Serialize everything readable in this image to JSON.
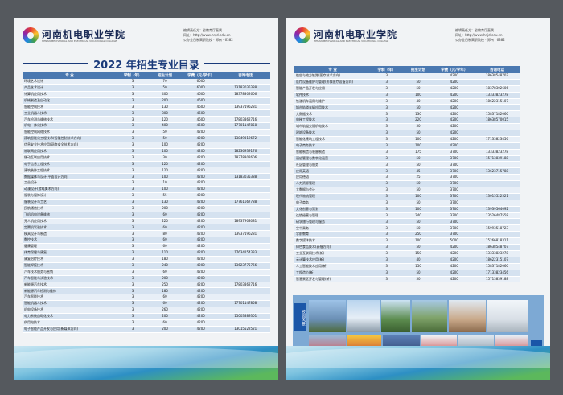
{
  "school_name_cn": "河南机电职业学院",
  "school_name_en": "HENAN MECHANICAL AND ELECTRICAL VOCATIONAL COLLEGE",
  "contact": [
    "编辑责任方：省教育厅直属",
    "网址：http://www.hnjd.edu.cn",
    "公办全日制高职院校 · 郑州 · 6382"
  ],
  "catalog_title": "2022 年招生专业目录",
  "headers": [
    "专 业",
    "学制（年）",
    "招生计划",
    "学费（元/学年）",
    "咨询电话"
  ],
  "left_rows": [
    [
      "环境艺术设计",
      "3",
      "70",
      "6000",
      ""
    ],
    [
      "产品艺术设计",
      "3",
      "50",
      "6000",
      "13183035388"
    ],
    [
      "计算机应用技术",
      "3",
      "400",
      "4600",
      "18378302606"
    ],
    [
      "机械制造及自动化",
      "3",
      "200",
      "4600",
      ""
    ],
    [
      "智能控制技术",
      "3",
      "130",
      "4600",
      "13937196281"
    ],
    [
      "工业机器人技术",
      "3",
      "300",
      "4600",
      ""
    ],
    [
      "汽车检测与维修技术",
      "3",
      "120",
      "4600",
      "17803862716"
    ],
    [
      "机电一体化技术",
      "3",
      "400",
      "4600",
      "17701147858"
    ],
    [
      "智能控制网络技术",
      "3",
      "50",
      "4200",
      ""
    ],
    [
      "建筑智能化工程技术(智能控制技术方向)",
      "3",
      "50",
      "4200",
      "13849319672"
    ],
    [
      "信息安全技术应用(网络安全技术方向)",
      "3",
      "100",
      "4200",
      ""
    ],
    [
      "物联网应用技术",
      "3",
      "100",
      "4200",
      "18236939176"
    ],
    [
      "移动互联应用技术",
      "3",
      "30",
      "4200",
      "18378302606"
    ],
    [
      "电子信息工程技术",
      "3",
      "120",
      "4200",
      ""
    ],
    [
      "建筑装饰工程技术",
      "3",
      "120",
      "4200",
      ""
    ],
    [
      "数据媒体与设计(平面设计方向)",
      "3",
      "100",
      "4200",
      "13183035388"
    ],
    [
      "工业设计",
      "3",
      "10",
      "4200",
      ""
    ],
    [
      "动漫设计(游戏美术方向)",
      "3",
      "100",
      "4200",
      ""
    ],
    [
      "服装与服饰设计",
      "3",
      "55",
      "4200",
      ""
    ],
    [
      "服装设计与工艺",
      "3",
      "130",
      "4200",
      "17761667788"
    ],
    [
      "民航通信技术",
      "3",
      "200",
      "4200",
      ""
    ],
    [
      "飞机机电设备维修",
      "3",
      "60",
      "4200",
      ""
    ],
    [
      "无人机应用技术",
      "3",
      "220",
      "4200",
      "18937908081"
    ],
    [
      "定翼机驾驶技术",
      "3",
      "60",
      "4200",
      ""
    ],
    [
      "模具设计与制造",
      "3",
      "80",
      "4200",
      "13937196281"
    ],
    [
      "数控技术",
      "3",
      "60",
      "4200",
      ""
    ],
    [
      "健康管理",
      "3",
      "60",
      "4200",
      ""
    ],
    [
      "体育保健与康复",
      "3",
      "110",
      "4200",
      "17634254333"
    ],
    [
      "康复治疗技术",
      "3",
      "180",
      "4200",
      ""
    ],
    [
      "智能焊接技术",
      "3",
      "240",
      "4200",
      "13623775766"
    ],
    [
      "汽车技术服务与营销",
      "3",
      "60",
      "4200",
      ""
    ],
    [
      "汽车智能与试验技术",
      "3",
      "200",
      "4200",
      ""
    ],
    [
      "新能源汽车技术",
      "3",
      "250",
      "4200",
      "17803862716"
    ],
    [
      "新能源汽车检测与维修",
      "3",
      "180",
      "4200",
      ""
    ],
    [
      "汽车智能技术",
      "3",
      "60",
      "4200",
      ""
    ],
    [
      "智能机器人技术",
      "3",
      "60",
      "4200",
      "17701147858"
    ],
    [
      "机电设备技术",
      "3",
      "260",
      "4200",
      ""
    ],
    [
      "电力系统自动化技术",
      "3",
      "200",
      "4200",
      "15003889301"
    ],
    [
      "供用电技术",
      "3",
      "60",
      "4200",
      ""
    ],
    [
      "电子智能产品开发与应用(新媒体方向)",
      "3",
      "200",
      "4200",
      "13015522521"
    ]
  ],
  "right_rows": [
    [
      "航空与地方铁路(医疗技术方向)",
      "3",
      "",
      "4200",
      "18638548707"
    ],
    [
      "医疗设备维护与管理(影像医疗设备方向)",
      "3",
      "50",
      "4200",
      ""
    ],
    [
      "智能产品开发与应用",
      "3",
      "50",
      "4200",
      "18378302606"
    ],
    [
      "软件技术",
      "3",
      "100",
      "4200",
      "13333823278"
    ],
    [
      "铁道机车运用与维护",
      "3",
      "40",
      "4200",
      "18622315107"
    ],
    [
      "城市轨道车辆应用技术",
      "3",
      "50",
      "4200",
      ""
    ],
    [
      "大数据技术",
      "3",
      "130",
      "4200",
      "15837182060"
    ],
    [
      "电梯工程技术",
      "3",
      "220",
      "4200",
      "18638570015"
    ],
    [
      "城市轨道交通机电技术",
      "3",
      "50",
      "4200",
      ""
    ],
    [
      "建筑设备技术",
      "3",
      "50",
      "4200",
      ""
    ],
    [
      "智能化建筑工程技术",
      "3",
      "100",
      "4200",
      "17133823456"
    ],
    [
      "电子商务技术",
      "3",
      "100",
      "4200",
      ""
    ],
    [
      "智能制造与装备制造",
      "3",
      "175",
      "3700",
      "13333823278"
    ],
    [
      "酒店管理与数字化运营",
      "3",
      "50",
      "3700",
      "15713839188"
    ],
    [
      "社区管理与服务",
      "3",
      "50",
      "3700",
      ""
    ],
    [
      "应用英语",
      "3",
      "45",
      "3700",
      "13623715788"
    ],
    [
      "应用德语",
      "3",
      "25",
      "3700",
      ""
    ],
    [
      "人力资源管理",
      "3",
      "50",
      "3700",
      ""
    ],
    [
      "大数据与会计",
      "3",
      "50",
      "3700",
      ""
    ],
    [
      "现代物流管理",
      "3",
      "100",
      "3700",
      "13015522521"
    ],
    [
      "电子商务",
      "3",
      "50",
      "3700",
      ""
    ],
    [
      "文化创意与策划",
      "3",
      "100",
      "3700",
      "13939564092"
    ],
    [
      "连锁经营与管理",
      "3",
      "240",
      "3700",
      "13526487558"
    ],
    [
      "研学旅行管理与服务",
      "3",
      "50",
      "3700",
      ""
    ],
    [
      "空中乘务",
      "3",
      "50",
      "3700",
      "15993518723"
    ],
    [
      "学前教育",
      "3",
      "250",
      "3700",
      ""
    ],
    [
      "数字媒体技术",
      "3",
      "100",
      "5000",
      "15266818311"
    ],
    [
      "绿色食品技术(养殖方向)",
      "3",
      "50",
      "4200",
      "18638548707"
    ],
    [
      "工业互联网技术(新)",
      "3",
      "150",
      "4200",
      "13333823278"
    ],
    [
      "云计算技术应用(新)",
      "3",
      "40",
      "4200",
      "18622315107"
    ],
    [
      "人工智能技术应用(新)",
      "3",
      "150",
      "4200",
      "15837182060"
    ],
    [
      "工程造价(新)",
      "3",
      "50",
      "4200",
      "17133823456"
    ],
    [
      "智慧景区开发与管理(新)",
      "3",
      "50",
      "4200",
      "15713839188"
    ]
  ],
  "photo_badge_left": "校园风景",
  "photo_badge_right": "学生风采"
}
